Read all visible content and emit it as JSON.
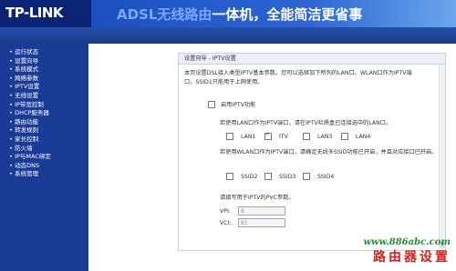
{
  "header": {
    "logo_text": "TP-LINK",
    "slogan_part1": "ADSL无线路由",
    "slogan_part2": "一体机，全能简洁更省事"
  },
  "sidebar": {
    "items": [
      {
        "label": "运行状态"
      },
      {
        "label": "设置向导"
      },
      {
        "label": "系统模式"
      },
      {
        "label": "网络参数"
      },
      {
        "label": "IPTV设置"
      },
      {
        "label": "无线设置"
      },
      {
        "label": "IP带宽控制"
      },
      {
        "label": "DHCP服务器"
      },
      {
        "label": "路由功能"
      },
      {
        "label": "转发规则"
      },
      {
        "label": "家长控制"
      },
      {
        "label": "防火墙"
      },
      {
        "label": "IP与MAC绑定"
      },
      {
        "label": "动态DNS"
      },
      {
        "label": "系统管理"
      }
    ]
  },
  "panel": {
    "breadcrumb": "设置向导 - IPTV设置",
    "description": "本页设置DSL接入类型IPTV基本参数。您可以选择加下所列的LAN口、WLAN口作为IPTV端口，SSID1只能用于上网使用。",
    "enable_label": "启用IPTV功能",
    "lan_hint": "若使用LAN口作为IPTV端口，请在IPTV栏质盒已连接选中的LAN口。",
    "lan_options": [
      {
        "label": "LAN1",
        "checked": false
      },
      {
        "label": "ITV",
        "checked": true
      },
      {
        "label": "LAN3",
        "checked": false
      },
      {
        "label": "LAN4",
        "checked": false
      }
    ],
    "wlan_hint": "若使用WLAN口作为IPTV端口，请确定无线多SSID功能已开启，并且对应接口已开启。",
    "ssid_options": [
      {
        "label": "SSID2",
        "checked": false
      },
      {
        "label": "SSID3",
        "checked": false
      },
      {
        "label": "SSID4",
        "checked": false
      }
    ],
    "pvc_title": "请填写用于IPTV的PVC参数。",
    "vpi_label": "VPI:",
    "vpi_value": "8",
    "vci_label": "VCI:",
    "vci_value": "81"
  },
  "watermark": {
    "url": "www.886abc.com",
    "text": "路由器设置"
  }
}
